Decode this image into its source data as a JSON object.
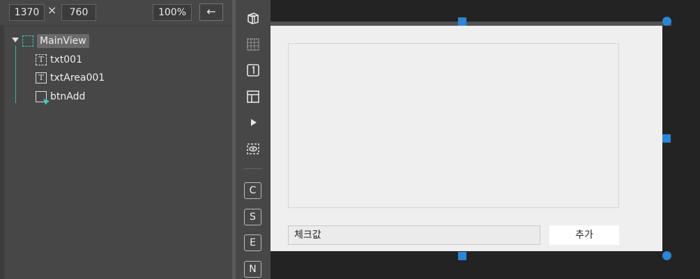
{
  "toolbar": {
    "width_value": "1370",
    "times_symbol": "×",
    "height_value": "760",
    "zoom_value": "100%",
    "back_symbol": "←"
  },
  "tree": {
    "root": {
      "label": "MainView",
      "icon": "view-icon"
    },
    "children": [
      {
        "label": "txt001",
        "icon": "text-field-icon"
      },
      {
        "label": "txtArea001",
        "icon": "text-area-icon"
      },
      {
        "label": "btnAdd",
        "icon": "button-icon"
      }
    ]
  },
  "tools": {
    "icons": [
      "layers-icon",
      "grid-icon",
      "page-number-icon",
      "layout-icon",
      "play-icon",
      "preview-icon"
    ],
    "letters": [
      "C",
      "S",
      "E",
      "N"
    ]
  },
  "canvas": {
    "input_value": "체크값",
    "add_button_label": "추가"
  },
  "colors": {
    "accent": "#2a86d6",
    "teal": "#35d0c0"
  }
}
